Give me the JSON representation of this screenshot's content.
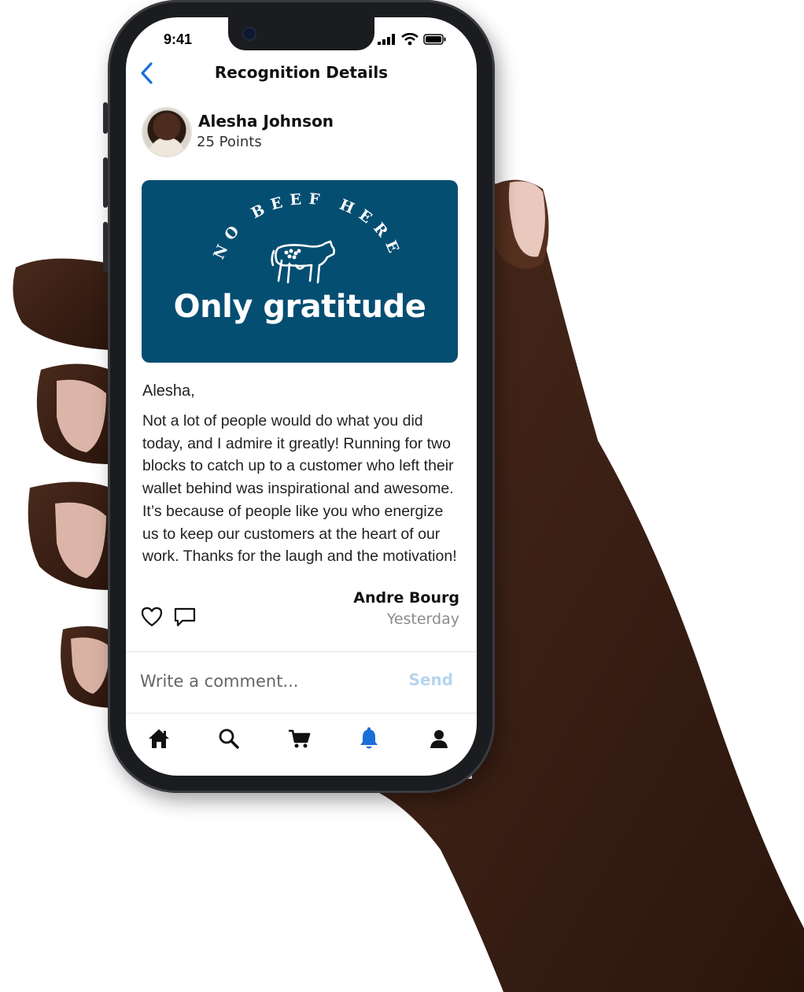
{
  "status_bar": {
    "time": "9:41"
  },
  "header": {
    "title": "Recognition Details"
  },
  "recipient": {
    "name": "Alesha Johnson",
    "points": "25 Points"
  },
  "card": {
    "arc_text": "NO BEEF HERE",
    "headline": "Only gratitude",
    "background_color": "#044e72"
  },
  "message": {
    "greeting": "Alesha,",
    "body": "Not a lot of people would do what you did today, and I admire it greatly! Running for two blocks to catch up to a customer who left their wallet behind was inspirational and awesome. It’s because of people like you who energize us to keep our customers at the heart of our work. Thanks for the laugh and the motivation!",
    "author": "Andre Bourg",
    "time": "Yesterday"
  },
  "comment": {
    "placeholder": "Write a comment...",
    "send_label": "Send"
  },
  "tabs": [
    {
      "icon": "home-icon"
    },
    {
      "icon": "search-icon"
    },
    {
      "icon": "cart-icon"
    },
    {
      "icon": "bell-icon",
      "active": true
    },
    {
      "icon": "profile-icon"
    }
  ],
  "colors": {
    "accent": "#1a6fd6",
    "send_disabled": "#b7d4ef"
  }
}
